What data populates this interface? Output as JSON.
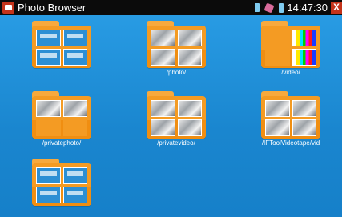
{
  "app": {
    "title": "Photo Browser"
  },
  "status": {
    "time": "14:47:30",
    "close_symbol": "X"
  },
  "folders": [
    {
      "label": ""
    },
    {
      "label": "/photo/"
    },
    {
      "label": "/video/"
    },
    {
      "label": "/privatephoto/"
    },
    {
      "label": "/privatevideo/"
    },
    {
      "label": "/IFToolVideotape/vid"
    },
    {
      "label": ""
    }
  ]
}
